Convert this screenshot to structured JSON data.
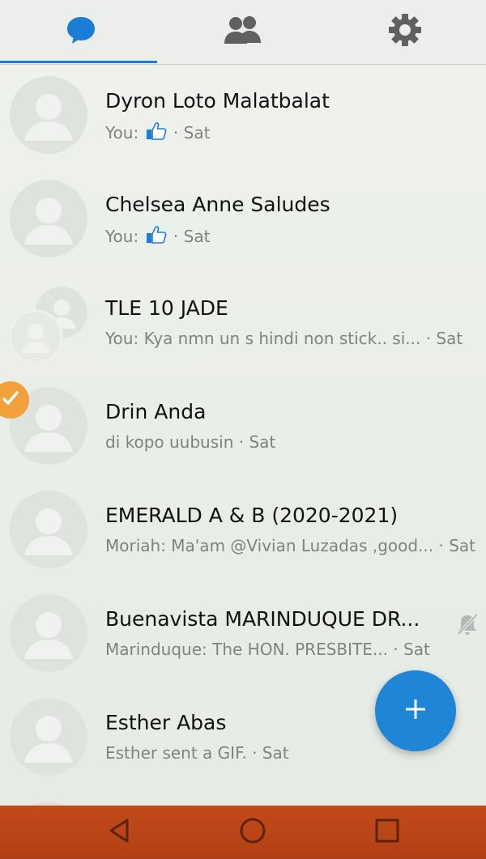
{
  "tabs": [
    {
      "icon": "chat-bubble-icon",
      "active": true
    },
    {
      "icon": "people-icon",
      "active": false
    },
    {
      "icon": "gear-icon",
      "active": false
    }
  ],
  "colors": {
    "accent": "#1b7ed6",
    "fab": "#1f86d6",
    "navbar": "#b9441a",
    "badge": "#f2a03a"
  },
  "conversations": [
    {
      "name": "Dyron Loto Malatbalat",
      "prefix": "You: ",
      "like": true,
      "message": "",
      "time": " · Sat"
    },
    {
      "name": "Chelsea Anne Saludes",
      "prefix": "You: ",
      "like": true,
      "message": "",
      "time": " · Sat"
    },
    {
      "name": "TLE 10 JADE",
      "prefix": "",
      "like": false,
      "message": "You: Kya nmn un s hindi non stick.. si...",
      "time": " · Sat"
    },
    {
      "name": "Drin Anda",
      "prefix": "",
      "like": false,
      "message": "di kopo uubusin",
      "time": " · Sat"
    },
    {
      "name": "EMERALD A & B (2020-2021)",
      "prefix": "",
      "like": false,
      "message": "Moriah: Ma'am @Vivian Luzadas ,good...",
      "time": " · Sat"
    },
    {
      "name": "Buenavista MARINDUQUE DR...",
      "prefix": "",
      "like": false,
      "message": "Marinduque: The HON. PRESBITE...",
      "time": " · Sat"
    },
    {
      "name": "Esther Abas",
      "prefix": "",
      "like": false,
      "message": "Esther sent a GIF.",
      "time": " · Sat"
    }
  ],
  "fab": {
    "label": "+"
  },
  "nav": [
    {
      "icon": "back-triangle-icon"
    },
    {
      "icon": "home-circle-icon"
    },
    {
      "icon": "recents-square-icon"
    }
  ]
}
